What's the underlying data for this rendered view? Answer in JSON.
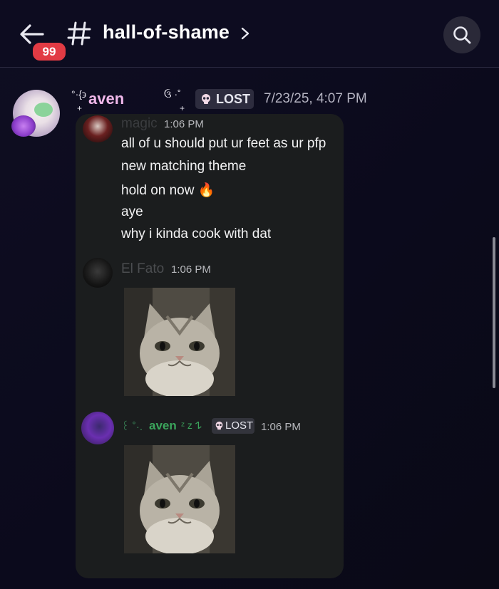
{
  "header": {
    "back_icon": "arrow-left-icon",
    "unread_badge": "99",
    "channel_icon": "hash-icon",
    "channel_name": "hall-of-shame",
    "channel_chevron": "chevron-right-icon",
    "search_icon": "search-icon"
  },
  "message": {
    "author_deco_left": "°·{϶",
    "author_deco_left_sub": "+",
    "author_name": "aven",
    "author_deco_right": "ઉ ·˚",
    "author_deco_right_sub": "+",
    "tag_label": "LOST",
    "timestamp": "7/23/25, 4:07 PM"
  },
  "forwarded": {
    "magic": {
      "name": "magic",
      "time": "1:06 PM",
      "lines": [
        "all of u should put ur feet as ur pfp",
        "new matching theme",
        "hold on now 🔥",
        "aye",
        "why i kinda cook with dat"
      ]
    },
    "elfato": {
      "name": "El Fato",
      "time": "1:06 PM"
    },
    "aven": {
      "name_prefix": "꒰ ˚·.",
      "name": "aven",
      "name_suffix": "ᶻ z 𐰁",
      "tag_label": "LOST",
      "time": "1:06 PM"
    }
  },
  "colors": {
    "background": "#0d0c20",
    "card": "#1b1d1e",
    "badge": "#e23b44",
    "author_name": "#f0b8ea",
    "inner_name_green": "#3ba55c"
  }
}
